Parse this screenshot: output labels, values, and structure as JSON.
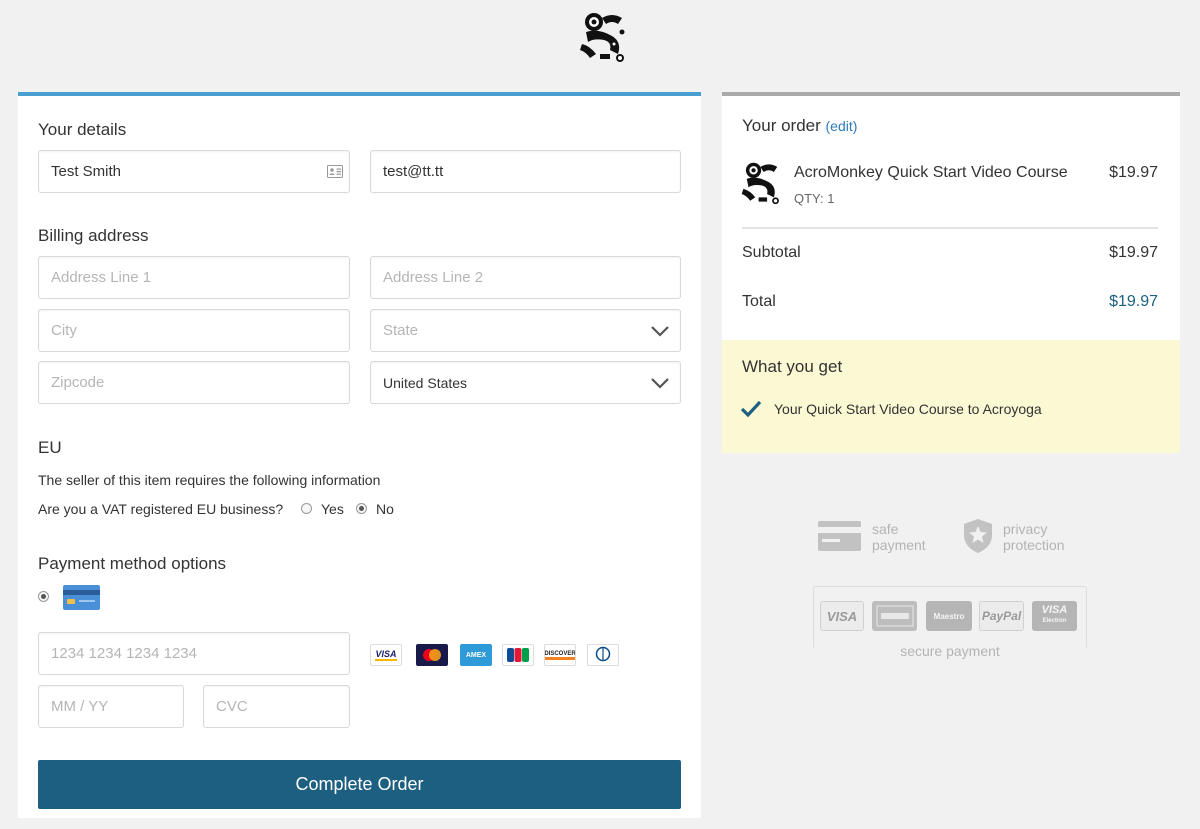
{
  "details": {
    "title": "Your details",
    "name_value": "Test Smith",
    "email_value": "test@tt.tt"
  },
  "billing": {
    "title": "Billing address",
    "address1_placeholder": "Address Line 1",
    "address2_placeholder": "Address Line 2",
    "city_placeholder": "City",
    "state_placeholder": "State",
    "zip_placeholder": "Zipcode",
    "country_value": "United States"
  },
  "eu": {
    "title": "EU",
    "info": "The seller of this item requires the following information",
    "question": "Are you a VAT registered EU business?",
    "yes_label": "Yes",
    "no_label": "No",
    "selected": "No"
  },
  "payment": {
    "title": "Payment method options",
    "card_placeholder": "1234 1234 1234 1234",
    "expiry_placeholder": "MM / YY",
    "cvc_placeholder": "CVC",
    "card_brands": [
      "visa",
      "mastercard",
      "amex",
      "jcb",
      "discover",
      "diners-club"
    ],
    "card_brand_labels": {
      "visa": "VISA",
      "amex": "AMEX",
      "discover": "DISCOVER"
    },
    "complete_label": "Complete Order"
  },
  "order": {
    "title": "Your order",
    "edit_label": "(edit)",
    "product_name": "AcroMonkey Quick Start Video Course",
    "product_qty": "QTY: 1",
    "product_price": "$19.97",
    "subtotal_label": "Subtotal",
    "subtotal_value": "$19.97",
    "total_label": "Total",
    "total_value": "$19.97"
  },
  "what_you_get": {
    "title": "What you get",
    "item": "Your Quick Start Video Course to Acroyoga"
  },
  "trust": {
    "safe_line1": "safe",
    "safe_line2": "payment",
    "privacy_line1": "privacy",
    "privacy_line2": "protection",
    "secure_label": "secure payment",
    "logos": {
      "visa": "VISA",
      "paypal": "PayPal",
      "maestro": "Maestro",
      "visa_electron": "VISA",
      "electron": "Electron"
    }
  },
  "colors": {
    "accent_blue": "#4a9fd1",
    "button": "#1c5f80",
    "total": "#1c5f80",
    "highlight_bg": "#fbf8d4"
  }
}
